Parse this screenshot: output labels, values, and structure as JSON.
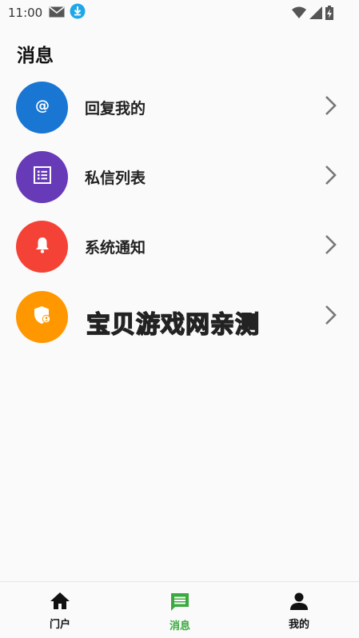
{
  "status_bar": {
    "time": "11:00",
    "icons": [
      "mail-icon",
      "download-icon",
      "wifi-icon",
      "signal-icon",
      "battery-charging-icon"
    ]
  },
  "header": {
    "title": "消息"
  },
  "list": {
    "items": [
      {
        "label": "回复我的",
        "icon": "at-sign-icon",
        "color": "#1976d2"
      },
      {
        "label": "私信列表",
        "icon": "list-icon",
        "color": "#673ab7"
      },
      {
        "label": "系统通知",
        "icon": "bell-icon",
        "color": "#f44336"
      },
      {
        "label": "",
        "icon": "shield-user-icon",
        "color": "#ff9800"
      }
    ]
  },
  "watermark": {
    "text": "宝贝游戏网亲测"
  },
  "tab_bar": {
    "active_color": "#3aaa3e",
    "tabs": [
      {
        "label": "门户",
        "icon": "home-icon",
        "active": false
      },
      {
        "label": "消息",
        "icon": "message-icon",
        "active": true
      },
      {
        "label": "我的",
        "icon": "person-icon",
        "active": false
      }
    ]
  }
}
